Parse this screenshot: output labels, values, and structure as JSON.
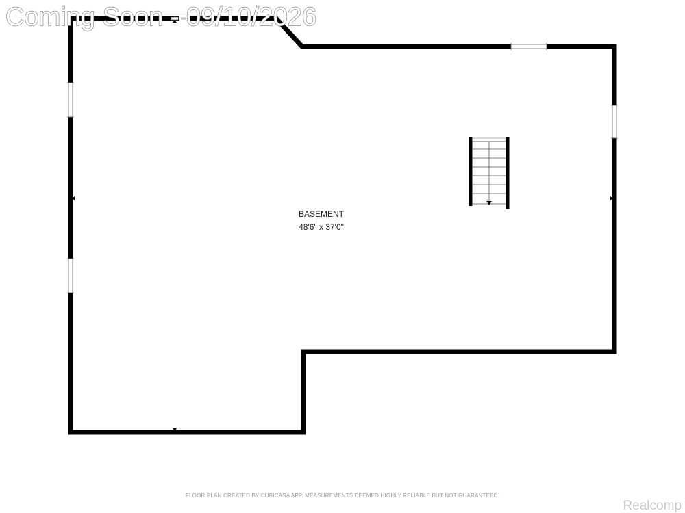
{
  "watermark": {
    "text": "Coming Soon - 09/10/2026"
  },
  "room": {
    "name": "BASEMENT",
    "dimensions": "48'6\" x 37'0\""
  },
  "footer": {
    "disclaimer": "FLOOR PLAN CREATED BY CUBICASA APP. MEASUREMENTS DEEMED HIGHLY RELIABLE BUT NOT GUARANTEED.",
    "brand": "Realcomp"
  },
  "colors": {
    "wall": "#000000",
    "background": "#ffffff",
    "watermark_outline": "#8a8a8a",
    "footer_text": "#9a9a9a",
    "brand_text": "#c8c8c8"
  },
  "icons": {
    "stairs": "staircase-down-arrow",
    "windows": "window-symbol"
  }
}
